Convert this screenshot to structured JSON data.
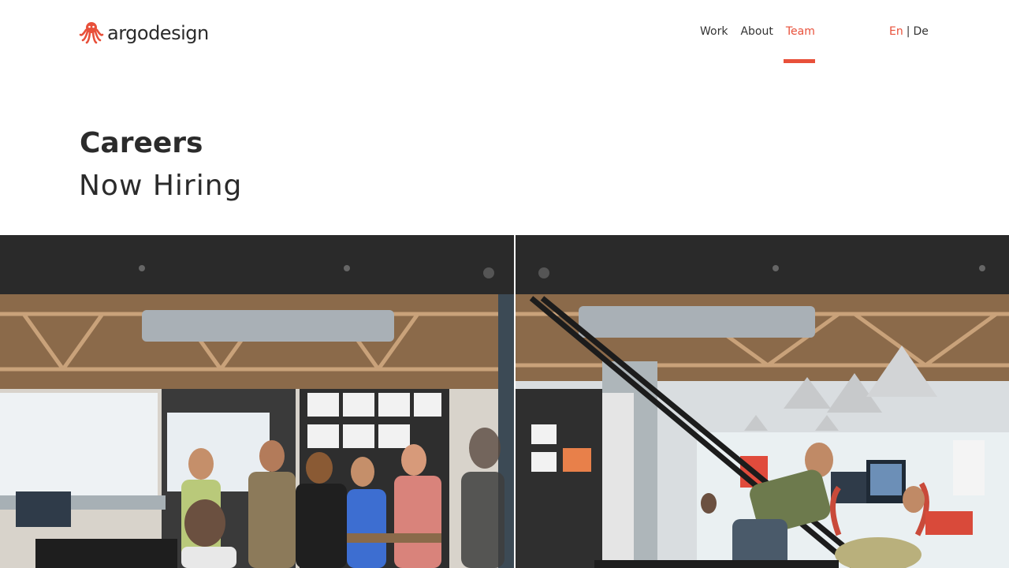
{
  "header": {
    "logo_text": "argodesign",
    "nav": [
      {
        "label": "Work",
        "active": false
      },
      {
        "label": "About",
        "active": false
      },
      {
        "label": "Team",
        "active": true
      }
    ],
    "lang": {
      "en": "En",
      "separator": "|",
      "de": "De",
      "active": "En"
    }
  },
  "page": {
    "title": "Careers",
    "subtitle": "Now Hiring"
  },
  "images": {
    "left": "office-team-photo",
    "right": "office-workspace-photo"
  },
  "colors": {
    "accent": "#e8503a",
    "text": "#2b2b2b",
    "background": "#ffffff"
  }
}
